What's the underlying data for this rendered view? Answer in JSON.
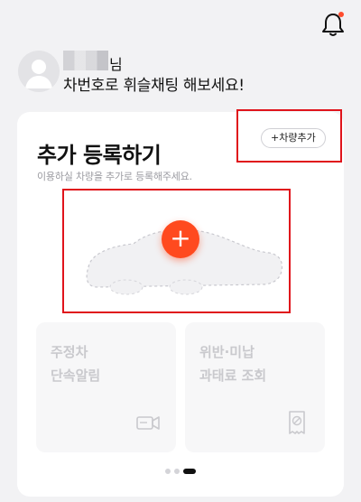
{
  "header": {
    "bell_icon": "bell-icon",
    "has_notification": true
  },
  "user": {
    "name_suffix": "님",
    "greeting": "차번호로 휘슬채팅 해보세요!"
  },
  "card": {
    "title": "추가 등록하기",
    "subtitle": "이용하실 차량을 추가로 등록해주세요.",
    "add_vehicle_button": "+차량추가",
    "plus_label": "+"
  },
  "tiles": [
    {
      "label": "주정차\n단속알림",
      "icon": "camera-icon"
    },
    {
      "label": "위반·미납\n과태료 조회",
      "icon": "receipt-icon"
    }
  ],
  "pagination": {
    "total": 3,
    "current": 3
  },
  "colors": {
    "accent": "#ff4a1f",
    "highlight": "#e0141b"
  }
}
